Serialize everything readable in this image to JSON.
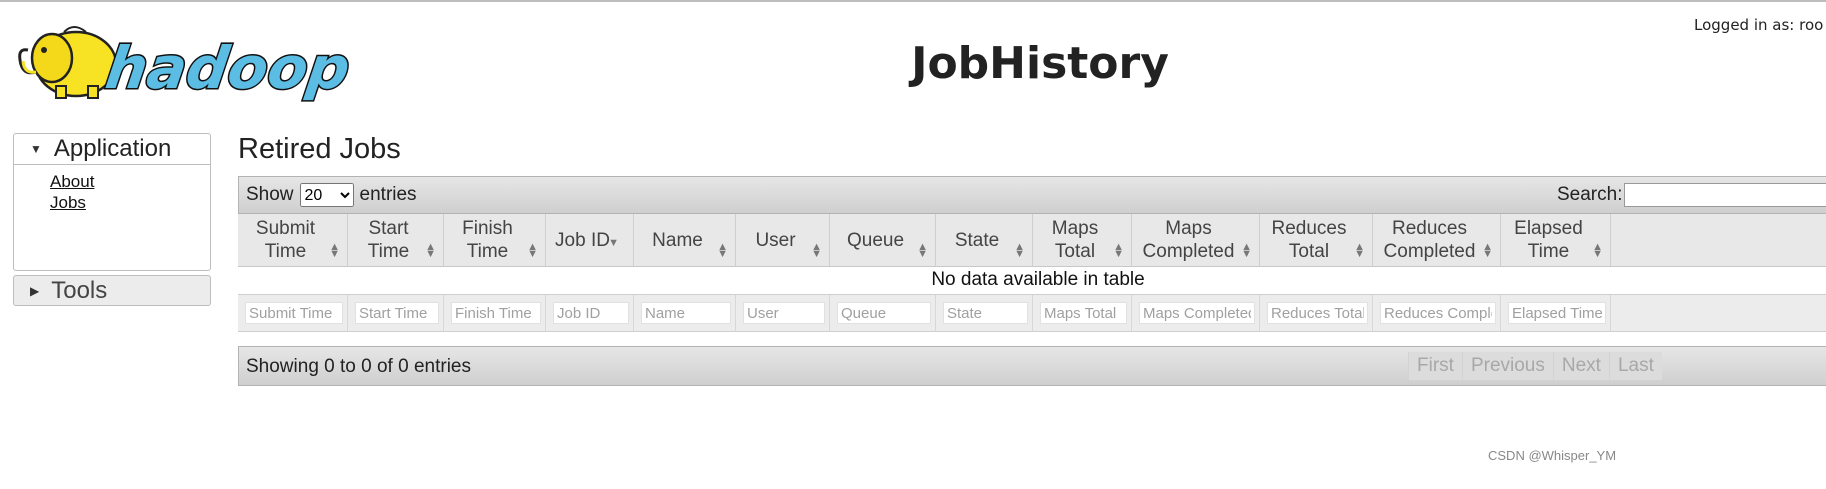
{
  "header": {
    "logo_text": "hadoop",
    "title": "JobHistory",
    "logged_in": "Logged in as: roo"
  },
  "sidebar": {
    "application": {
      "label": "Application",
      "links": [
        "About",
        "Jobs"
      ]
    },
    "tools": {
      "label": "Tools"
    }
  },
  "main": {
    "section_title": "Retired Jobs",
    "length": {
      "show": "Show",
      "entries": "entries",
      "selected": "20",
      "options": [
        "20"
      ]
    },
    "search_label": "Search:",
    "columns": [
      "Submit Time",
      "Start Time",
      "Finish Time",
      "Job ID",
      "Name",
      "User",
      "Queue",
      "State",
      "Maps Total",
      "Maps Completed",
      "Reduces Total",
      "Reduces Completed",
      "Elapsed Time"
    ],
    "empty_message": "No data available in table",
    "filters": [
      "Submit Time",
      "Start Time",
      "Finish Time",
      "Job ID",
      "Name",
      "User",
      "Queue",
      "State",
      "Maps Total",
      "Maps Completed",
      "Reduces Total",
      "Reduces Complet",
      "Elapsed Time"
    ],
    "info": "Showing 0 to 0 of 0 entries",
    "pager": [
      "First",
      "Previous",
      "Next",
      "Last"
    ]
  },
  "watermark": "CSDN @Whisper_YM",
  "colors": {
    "logo_yellow": "#f7e224",
    "logo_blue": "#5bbde4",
    "toolbar_gray": "#d6d6d6"
  }
}
